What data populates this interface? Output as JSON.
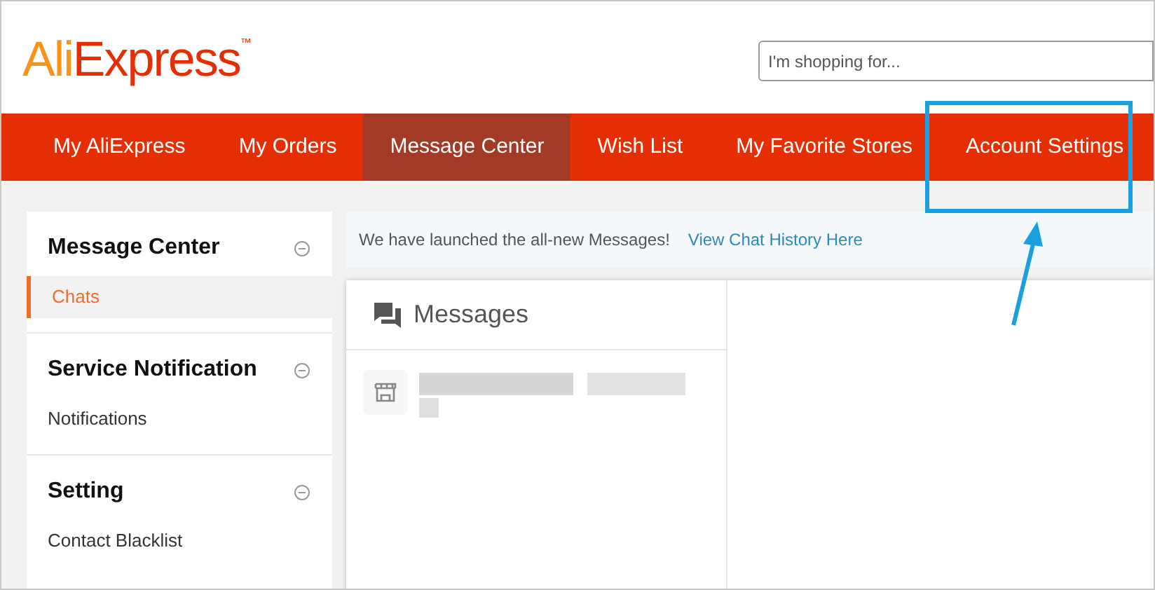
{
  "logo": {
    "first": "Ali",
    "second": "Express",
    "mark": "™"
  },
  "search": {
    "placeholder": "I'm shopping for..."
  },
  "nav": [
    {
      "label": "My AliExpress",
      "selected": false
    },
    {
      "label": "My Orders",
      "selected": false
    },
    {
      "label": "Message Center",
      "selected": true
    },
    {
      "label": "Wish List",
      "selected": false
    },
    {
      "label": "My Favorite Stores",
      "selected": false
    },
    {
      "label": "Account Settings",
      "selected": false
    }
  ],
  "sidebar": [
    {
      "title": "Message Center",
      "items": [
        {
          "label": "Chats",
          "selected": true
        }
      ]
    },
    {
      "title": "Service Notification",
      "items": [
        {
          "label": "Notifications",
          "selected": false
        }
      ]
    },
    {
      "title": "Setting",
      "items": [
        {
          "label": "Contact Blacklist",
          "selected": false
        }
      ]
    }
  ],
  "notice": {
    "text": "We have launched the all-new Messages!",
    "link": "View Chat History Here"
  },
  "messages": {
    "title": "Messages"
  }
}
